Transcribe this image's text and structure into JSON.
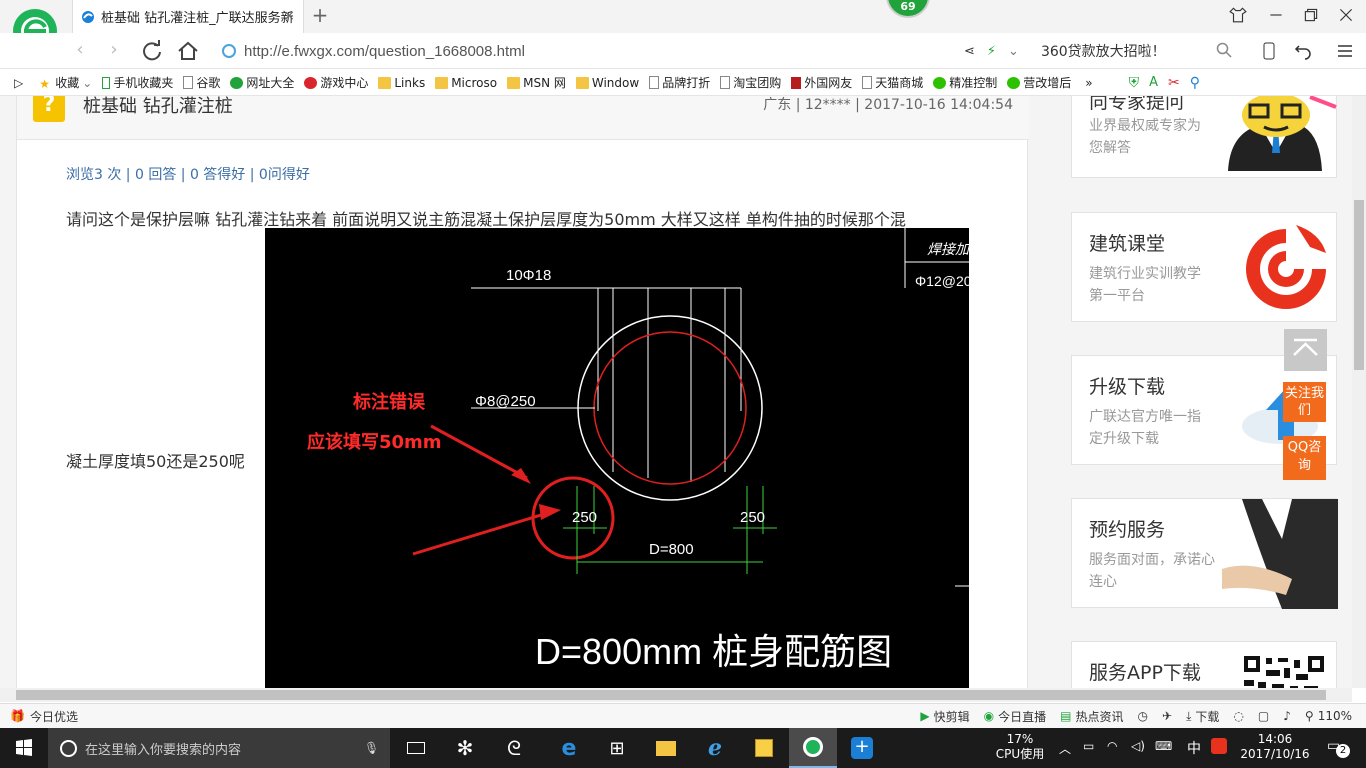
{
  "browser": {
    "tab_title": "桩基础 钻孔灌注桩_广联达服务新",
    "tab_close": "×",
    "new_tab": "+",
    "badge": "69",
    "url": "http://e.fwxgx.com/question_1668008.html",
    "promo": "360贷款放大招啦！"
  },
  "bookmarks": [
    {
      "label": "收藏",
      "icon": "star-icon"
    },
    {
      "label": "手机收藏夹",
      "icon": "phone-icon"
    },
    {
      "label": "谷歌",
      "icon": "page-icon"
    },
    {
      "label": "网址大全",
      "icon": "globe-icon"
    },
    {
      "label": "游戏中心",
      "icon": "game-icon"
    },
    {
      "label": "Links",
      "icon": "folder-icon"
    },
    {
      "label": "Microso",
      "icon": "folder-icon"
    },
    {
      "label": "MSN 网",
      "icon": "folder-icon"
    },
    {
      "label": "Window",
      "icon": "folder-icon"
    },
    {
      "label": "品牌打折",
      "icon": "page-icon"
    },
    {
      "label": "淘宝团购",
      "icon": "page-icon"
    },
    {
      "label": "外国网友",
      "icon": "flag-icon"
    },
    {
      "label": "天猫商城",
      "icon": "page-icon"
    },
    {
      "label": "精准控制",
      "icon": "wechat-icon"
    },
    {
      "label": "营改增后",
      "icon": "wechat-icon"
    }
  ],
  "question": {
    "title": "桩基础 钻孔灌注桩",
    "meta": "广东 | 12**** | 2017-10-16 14:04:54",
    "stats": "浏览3 次 | 0 回答 | 0 答得好 | 0问得好",
    "text_line1": "请问这个是保护层嘛 钻孔灌注钻来着 前面说明又说主筋混凝土保护层厚度为50mm 大样又这样 单构件抽的时候那个混",
    "text_line2": "凝土厚度填50还是250呢"
  },
  "drawing": {
    "label_top_right": "焊接加劲箍",
    "label_rebar_top_right": "Φ12@20",
    "label_main_rebar": "10Φ18",
    "label_stirrup": "Φ8@250",
    "note_line1": "标注错误",
    "note_line2": "应该填写50mm",
    "dim_left": "250",
    "dim_right": "250",
    "dim_diameter": "D=800",
    "caption": "D=800mm 桩身配筋图"
  },
  "sidebar": [
    {
      "title": "向专家提问",
      "sub": "业界最权威专家为您解答"
    },
    {
      "title": "建筑课堂",
      "sub": "建筑行业实训教学第一平台"
    },
    {
      "title": "升级下载",
      "sub": "广联达官方唯一指定升级下载"
    },
    {
      "title": "预约服务",
      "sub": "服务面对面，承诺心连心"
    },
    {
      "title": "服务APP下载",
      "sub": ""
    }
  ],
  "float": {
    "follow": "关注我们",
    "qq": "QQ咨询"
  },
  "statusbar": {
    "left": "今日优选",
    "items": [
      "快剪辑",
      "今日直播",
      "热点资讯",
      "下载"
    ],
    "zoom": "110%"
  },
  "taskbar": {
    "search_placeholder": "在这里输入你要搜索的内容",
    "cpu_percent": "17%",
    "cpu_label": "CPU使用",
    "ime": "中",
    "time": "14:06",
    "date": "2017/10/16",
    "notifications": "2"
  }
}
